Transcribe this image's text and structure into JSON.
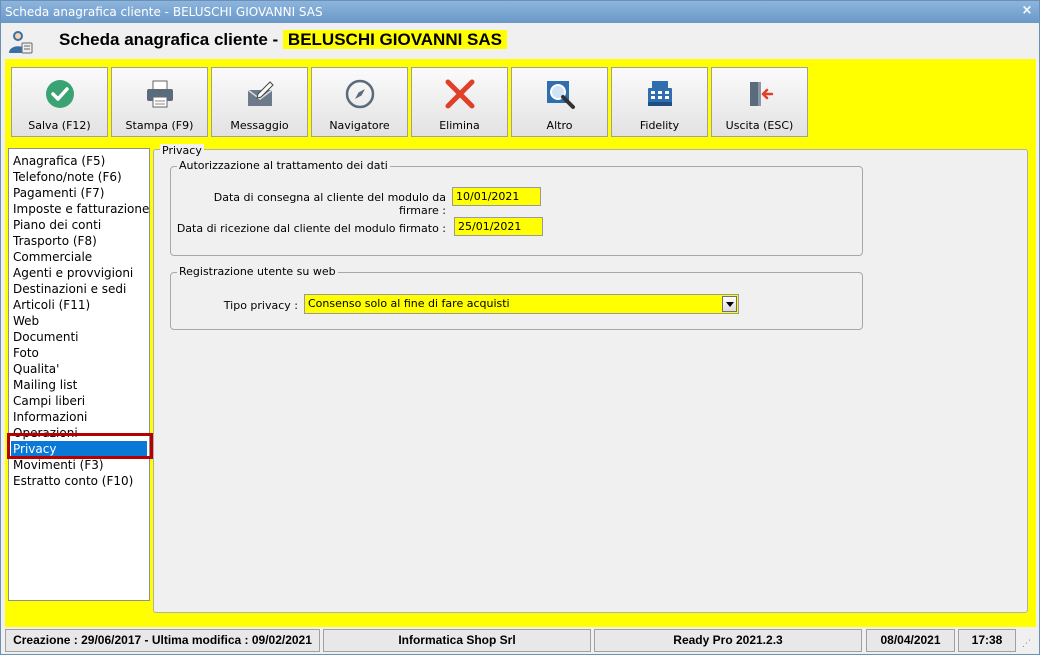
{
  "window": {
    "title": "Scheda anagrafica cliente - BELUSCHI GIOVANNI SAS",
    "close_glyph": "×"
  },
  "header": {
    "title_prefix": "Scheda anagrafica cliente - ",
    "client_name": "BELUSCHI GIOVANNI SAS",
    "avatar_icon": "user-card-icon"
  },
  "toolbar": {
    "buttons": [
      {
        "label": "Salva (F12)",
        "icon": "check-circle-icon"
      },
      {
        "label": "Stampa (F9)",
        "icon": "printer-icon"
      },
      {
        "label": "Messaggio",
        "icon": "compose-message-icon"
      },
      {
        "label": "Navigatore",
        "icon": "compass-icon"
      },
      {
        "label": "Elimina",
        "icon": "delete-x-icon"
      },
      {
        "label": "Altro",
        "icon": "magnifier-icon"
      },
      {
        "label": "Fidelity",
        "icon": "cash-register-icon"
      },
      {
        "label": "Uscita (ESC)",
        "icon": "exit-door-icon"
      }
    ]
  },
  "nav": {
    "items": [
      "Anagrafica (F5)",
      "Telefono/note (F6)",
      "Pagamenti (F7)",
      "Imposte e fatturazione",
      "Piano dei conti",
      "Trasporto (F8)",
      "Commerciale",
      "Agenti e provvigioni",
      "Destinazioni e sedi",
      "Articoli (F11)",
      "Web",
      "Documenti",
      "Foto",
      "Qualita'",
      "Mailing list",
      "Campi liberi",
      "Informazioni",
      "Operazioni",
      "Privacy",
      "Movimenti (F3)",
      "Estratto conto (F10)"
    ],
    "selected": "Privacy"
  },
  "privacy": {
    "section_title": "Privacy",
    "auth_group": {
      "legend": "Autorizzazione al trattamento dei dati",
      "consegna_label": "Data di consegna al cliente del modulo da firmare :",
      "consegna_value": "10/01/2021",
      "ricezione_label": "Data di ricezione dal cliente del modulo firmato :",
      "ricezione_value": "25/01/2021"
    },
    "web_group": {
      "legend": "Registrazione utente su web",
      "tipo_label": "Tipo privacy :",
      "tipo_value": "Consenso solo al fine di fare acquisti"
    }
  },
  "status": {
    "creazione": "Creazione : 29/06/2017 - Ultima modifica : 09/02/2021",
    "company": "Informatica Shop Srl",
    "version": "Ready Pro 2021.2.3",
    "date": "08/04/2021",
    "time": "17:38"
  },
  "colors": {
    "accent_yellow": "#ffff00",
    "selection_blue": "#0a78d7",
    "highlight_red": "#b40000"
  }
}
